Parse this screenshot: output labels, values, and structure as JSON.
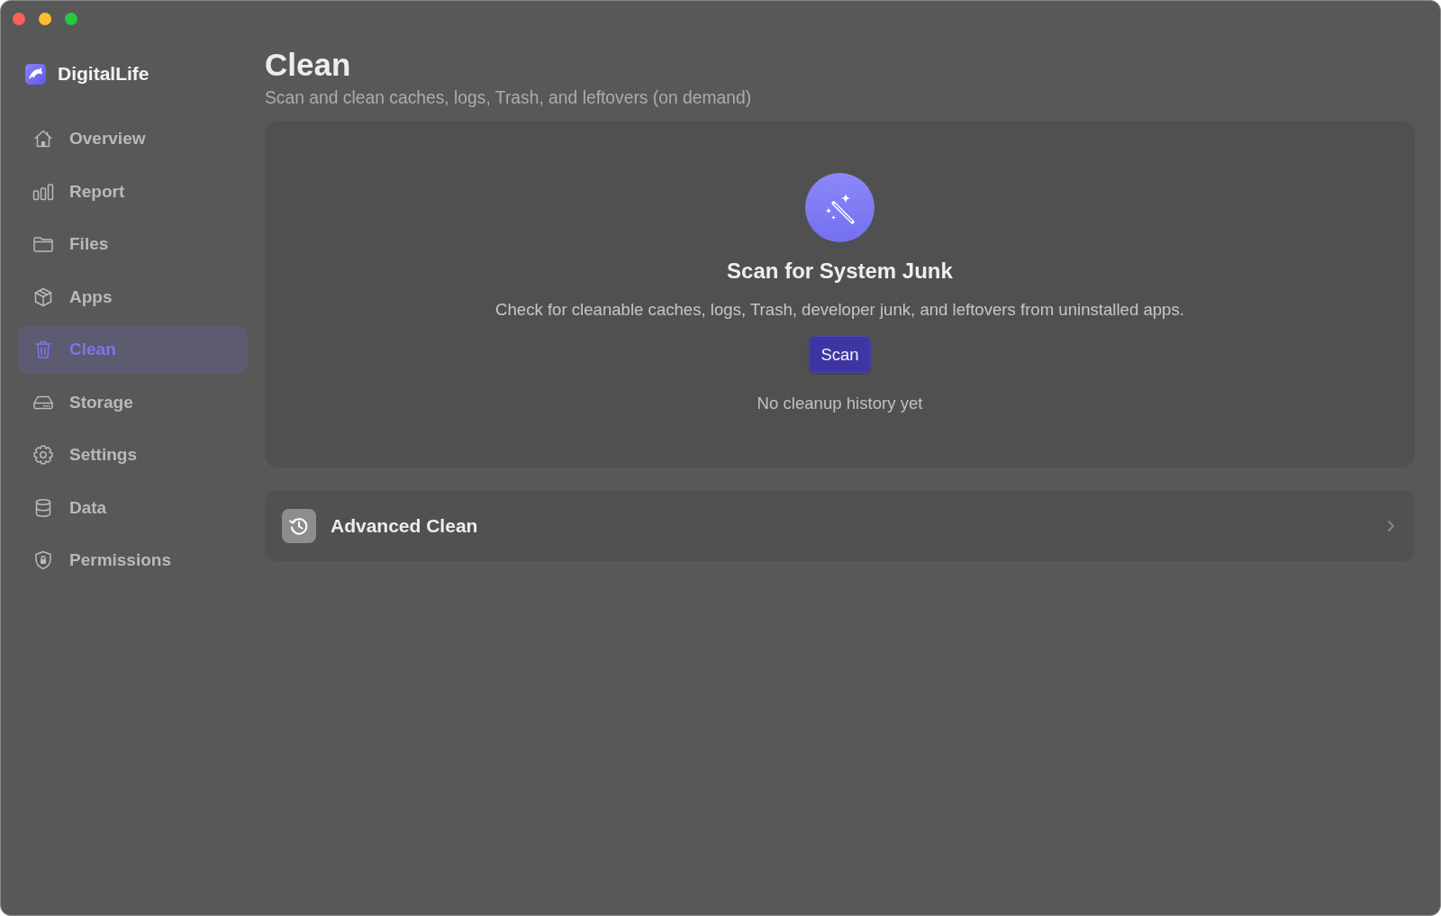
{
  "sidebar": {
    "app_name": "DigitalLife",
    "items": [
      {
        "label": "Overview",
        "selected": false
      },
      {
        "label": "Report",
        "selected": false
      },
      {
        "label": "Files",
        "selected": false
      },
      {
        "label": "Apps",
        "selected": false
      },
      {
        "label": "Clean",
        "selected": true
      },
      {
        "label": "Storage",
        "selected": false
      },
      {
        "label": "Settings",
        "selected": false
      },
      {
        "label": "Data",
        "selected": false
      },
      {
        "label": "Permissions",
        "selected": false
      }
    ]
  },
  "page": {
    "title": "Clean",
    "subtitle": "Scan and clean caches, logs, Trash, and leftovers (on demand)"
  },
  "scan_card": {
    "heading": "Scan for System Junk",
    "description": "Check for cleanable caches, logs, Trash, developer junk, and leftovers from uninstalled apps.",
    "button": "Scan",
    "history_note": "No cleanup history yet"
  },
  "advanced_row": {
    "label": "Advanced Clean"
  }
}
